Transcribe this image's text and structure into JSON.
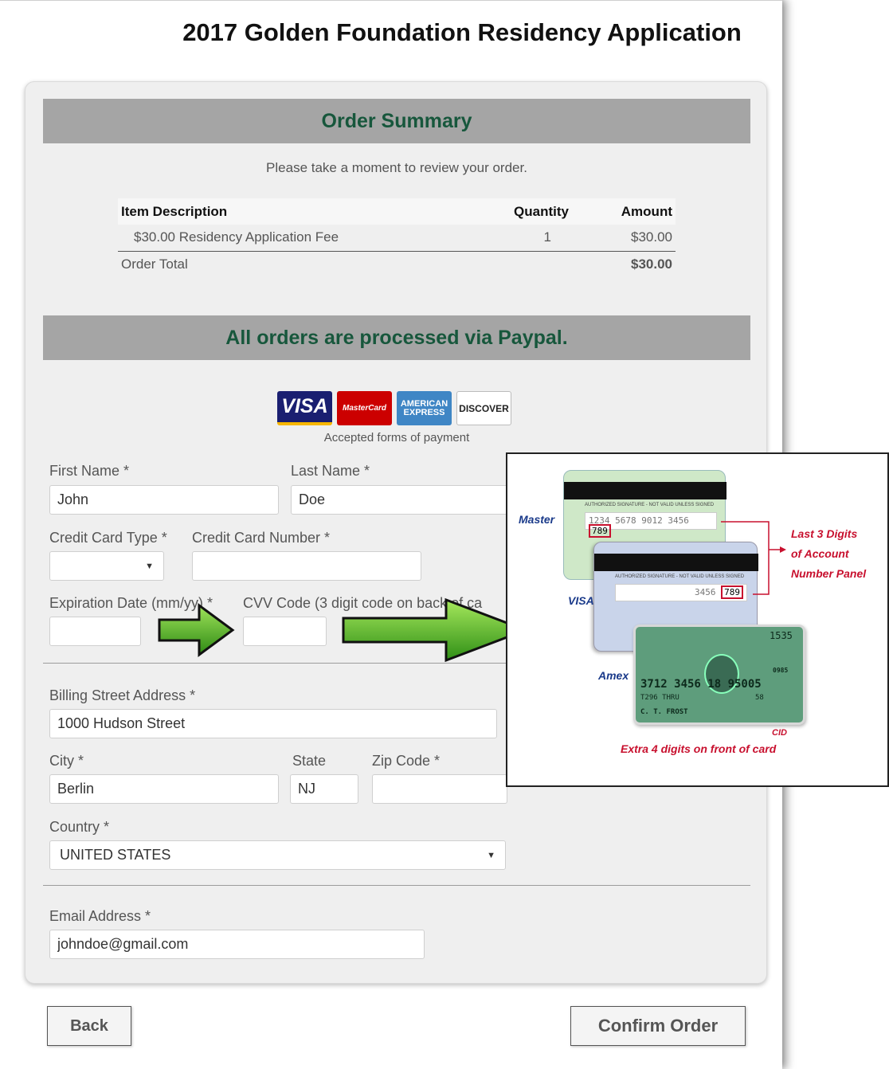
{
  "page": {
    "title": "2017 Golden Foundation Residency Application"
  },
  "order_summary": {
    "heading": "Order Summary",
    "intro": "Please take a moment to review your order.",
    "columns": {
      "description": "Item Description",
      "quantity": "Quantity",
      "amount": "Amount"
    },
    "items": [
      {
        "description": "$30.00 Residency Application Fee",
        "quantity": "1",
        "amount": "$30.00"
      }
    ],
    "total_label": "Order Total",
    "total_amount": "$30.00"
  },
  "payment": {
    "heading": "All orders are processed via Paypal.",
    "logos": {
      "visa": "VISA",
      "mastercard": "MasterCard",
      "amex_line1": "AMERICAN",
      "amex_line2": "EXPRESS",
      "discover": "DISCOVER"
    },
    "caption": "Accepted forms of payment"
  },
  "form": {
    "first_name": {
      "label": "First Name *",
      "value": "John"
    },
    "last_name": {
      "label": "Last Name *",
      "value": "Doe"
    },
    "card_type": {
      "label": "Credit Card Type *",
      "value": ""
    },
    "card_number": {
      "label": "Credit Card Number *",
      "value": ""
    },
    "expiration": {
      "label": "Expiration Date (mm/yy) *",
      "value": ""
    },
    "cvv": {
      "label": "CVV Code (3 digit code on back of ca",
      "value": ""
    },
    "street": {
      "label": "Billing Street Address *",
      "value": "1000 Hudson Street"
    },
    "city": {
      "label": "City *",
      "value": "Berlin"
    },
    "state": {
      "label": "State",
      "value": "NJ"
    },
    "zip": {
      "label": "Zip Code *",
      "value": ""
    },
    "country": {
      "label": "Country *",
      "value": "UNITED STATES"
    },
    "email": {
      "label": "Email Address *",
      "value": "johndoe@gmail.com"
    }
  },
  "buttons": {
    "back": "Back",
    "confirm": "Confirm Order"
  },
  "cvv_help": {
    "master_label": "Master",
    "visa_label": "VISA",
    "amex_label": "Amex",
    "signature_text": "AUTHORIZED SIGNATURE - NOT VALID UNLESS SIGNED",
    "master_number": "1234 5678 9012 3456",
    "master_code": "789",
    "visa_number": "3456",
    "visa_code": "789",
    "callout_line1": "Last 3 Digits",
    "callout_line2": "of Account",
    "callout_line3": "Number Panel",
    "amex_number": "3712 3456 18 95005",
    "amex_code": "0985",
    "amex_top_digits": "1535",
    "amex_sub": "T296 THRU",
    "amex_sub2": "58",
    "amex_name": "C. T. FROST",
    "cid_label": "CID",
    "amex_caption": "Extra 4 digits on front of card"
  },
  "colors": {
    "band": "#a5a5a5",
    "band_text": "#17573c",
    "help_red": "#c8102e",
    "help_blue": "#1a3a8a"
  }
}
